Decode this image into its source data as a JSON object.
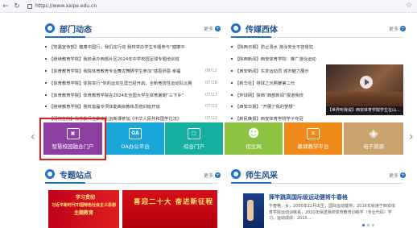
{
  "browser": {
    "url": "https://www.xaipe.edu.cn",
    "back_icon": "arrow-left-icon",
    "refresh_icon": "refresh-icon",
    "star_icon": "star-icon"
  },
  "news": {
    "title": "部门动态",
    "more": "更多",
    "items": [
      {
        "text": "【党委宣传部】健康中国行，我们在行动 我校举办学生专题参与“健康中",
        "date": ""
      },
      {
        "text": "【继续教育学院】我校承办西部片区2024年中学校园足球专题培训班",
        "date": ""
      },
      {
        "text": "【体育教育学院】我院体育教育专业舞龙舞狮学生参加“感恩师恩·幸福",
        "date": "08/12"
      },
      {
        "text": "【体育教育学院】体院举行“你的运动生涯已经开启，全新竞技性运动队比赛",
        "date": "07/28"
      },
      {
        "text": "【体育教育学院】体育教育学院在2024年全国大学生体育暑期“三下乡”",
        "date": "07/27"
      },
      {
        "text": "【继续教育学院】我校首届专项体能高级教练员培训班开班",
        "date": "07/22"
      },
      {
        "text": "【研究生院】我校教师在聚文化创新课参加《中华人民共和国学位法》",
        "date": "07/22"
      }
    ]
  },
  "media": {
    "title": "传媒西体",
    "more": "更多",
    "items": [
      {
        "text": "【陕西日报】防止溺水 游泳安全不容侵犯"
      },
      {
        "text": "【陕西新闻】西安体育学院：推广游泳运动"
      },
      {
        "text": "【西安新闻】东茶运动员 城市魅力展示"
      },
      {
        "text": "【新华社】排球之光照耀第二代"
      },
      {
        "text": "【环球网】陕西“西部新闻”报道我校"
      },
      {
        "text": "【西安日报】“开展了我的梦想”"
      },
      {
        "text": "【新民晚报】西安体育学院学子夺冠"
      }
    ],
    "caption": "【世界听我说】西安体育学院学生在山..."
  },
  "tiles": [
    {
      "label": "智慧校园融合门户",
      "color": "#8e3da3",
      "icon": "portal-icon"
    },
    {
      "label": "OA办公平台",
      "color": "#1aa6d9",
      "icon": "oa-icon"
    },
    {
      "label": "综合门户",
      "color": "#16b0a0",
      "icon": "monitor-icon"
    },
    {
      "label": "招生网",
      "color": "#8cc23f",
      "icon": "user-add-icon"
    },
    {
      "label": "慕课教学平台",
      "color": "#f08a1a",
      "icon": "book-icon"
    },
    {
      "label": "电子资源",
      "color": "#c9a36b",
      "icon": "layers-icon"
    }
  ],
  "topics": {
    "title": "专题站点",
    "more": "更多",
    "banner1": [
      "学习贯彻",
      "习近平新时代中国特色社会主义思想",
      "主题教育"
    ],
    "banner2": "喜迎二十大 奋进新征程"
  },
  "students": {
    "title": "师生风采",
    "more": "更多",
    "headline": "摔竿跳高国际级运动健将牛春格",
    "body": "牛春格，女，2000年12月出生，国际运动健将，2016年就读于西安体育学院运动训练系，2020年保送我校体育教育训练学（专业代码）学习。运动成绩：2015..."
  },
  "colors": {
    "accent": "#1f6fc5",
    "highlight": "#e02020"
  }
}
